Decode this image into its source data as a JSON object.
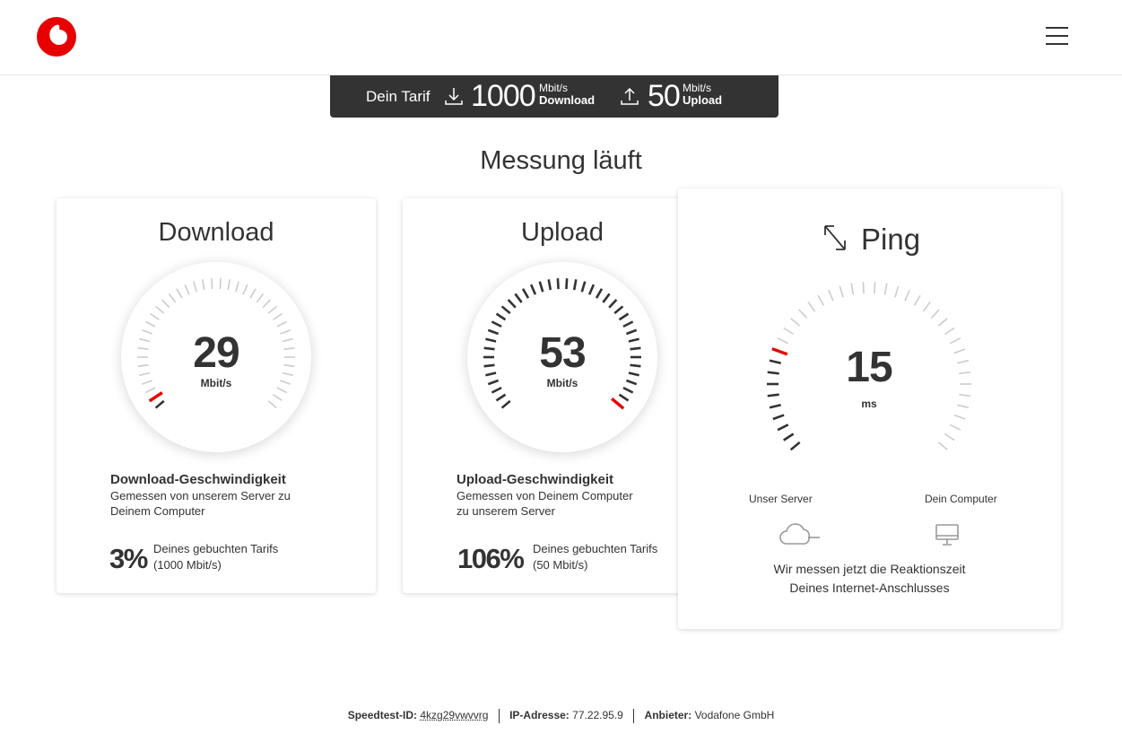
{
  "header": {
    "logo_icon": "vodafone-logo-icon",
    "menu_icon": "hamburger-menu-icon"
  },
  "tarif": {
    "label": "Dein Tarif",
    "download_value": "1000",
    "download_unit": "Mbit/s",
    "download_label": "Download",
    "upload_value": "50",
    "upload_unit": "Mbit/s",
    "upload_label": "Upload"
  },
  "status_title": "Messung läuft",
  "download": {
    "title": "Download",
    "value": "29",
    "unit": "Mbit/s",
    "level": 0.03,
    "desc_title": "Download-Geschwindigkeit",
    "desc_text": "Gemessen von unserem Server zu Deinem Computer",
    "percent": "3%",
    "percent_text_1": "Deines gebuchten Tarifs",
    "percent_text_2": "(1000 Mbit/s)"
  },
  "upload": {
    "title": "Upload",
    "value": "53",
    "unit": "Mbit/s",
    "level": 1.0,
    "desc_title": "Upload-Geschwindigkeit",
    "desc_text": "Gemessen von Deinem Computer zu unserem Server",
    "percent": "106%",
    "percent_text_1": "Deines gebuchten Tarifs",
    "percent_text_2": "(50 Mbit/s)"
  },
  "ping": {
    "title": "Ping",
    "value": "15",
    "unit": "ms",
    "level": 0.23,
    "server_label": "Unser Server",
    "computer_label": "Dein Computer",
    "text_1": "Wir messen jetzt die Reaktionszeit",
    "text_2": "Deines Internet-Anschlusses"
  },
  "footer": {
    "id_label": "Speedtest-ID:",
    "id_value": "4kzg29vwvvrg",
    "ip_label": "IP-Adresse:",
    "ip_value": "77.22.95.9",
    "provider_label": "Anbieter:",
    "provider_value": "Vodafone GmbH"
  },
  "colors": {
    "accent": "#e60000",
    "dark": "#333333",
    "tick_inactive": "#cccccc"
  }
}
